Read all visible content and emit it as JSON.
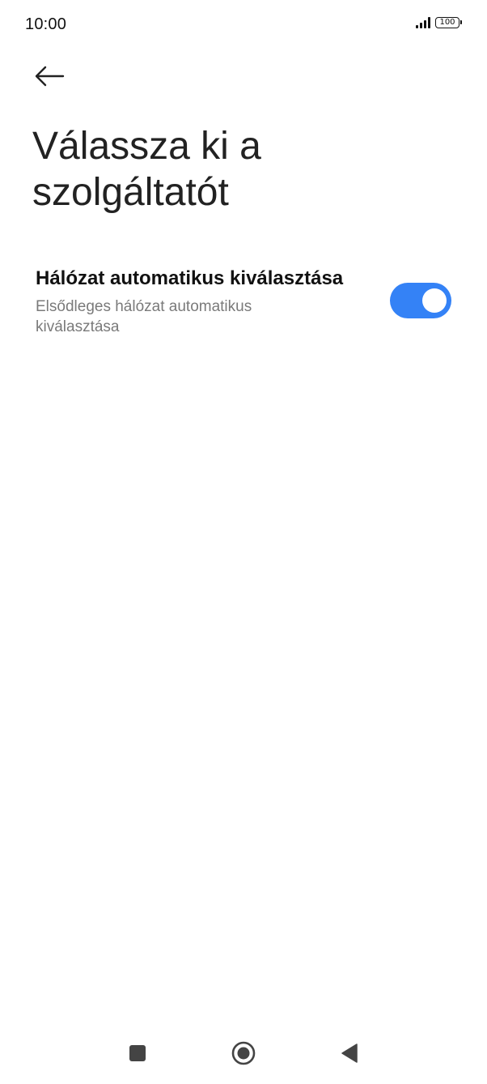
{
  "status_bar": {
    "time": "10:00",
    "battery_level": "100",
    "signal_icon": "signal-strength-icon",
    "battery_icon": "battery-icon"
  },
  "header": {
    "back_icon": "back-arrow-icon",
    "title": "Válassza ki a szolgáltatót"
  },
  "settings": {
    "auto_network": {
      "title": "Hálózat automatikus kiválasztása",
      "subtitle": "Elsődleges hálózat automatikus kiválasztása",
      "enabled": true,
      "toggle_color": "#3482f6"
    }
  },
  "nav_bar": {
    "recents_icon": "square-recents-icon",
    "home_icon": "circle-home-icon",
    "back_icon": "triangle-back-icon"
  }
}
